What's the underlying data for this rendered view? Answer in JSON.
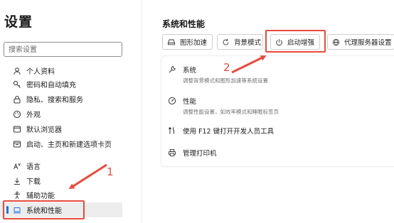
{
  "sidebar": {
    "title": "设置",
    "search_placeholder": "搜索设置",
    "items": [
      {
        "label": "个人资料",
        "icon": "profile-icon"
      },
      {
        "label": "密码和自动填充",
        "icon": "key-icon"
      },
      {
        "label": "隐私、搜索和服务",
        "icon": "lock-icon"
      },
      {
        "label": "外观",
        "icon": "appearance-icon"
      },
      {
        "label": "默认浏览器",
        "icon": "browser-icon"
      },
      {
        "label": "启动、主页和新建选项卡页",
        "icon": "power-icon"
      },
      {
        "label": "语言",
        "icon": "language-icon"
      },
      {
        "label": "下载",
        "icon": "download-icon"
      },
      {
        "label": "辅助功能",
        "icon": "accessibility-icon"
      },
      {
        "label": "系统和性能",
        "icon": "laptop-icon"
      }
    ]
  },
  "main": {
    "section_title": "系统和性能",
    "tabs": [
      {
        "label": "图形加速",
        "icon": "drive-icon"
      },
      {
        "label": "背景模式",
        "icon": "refresh-icon"
      },
      {
        "label": "启动增强",
        "icon": "power-icon"
      },
      {
        "label": "代理服务器设置",
        "icon": "globe-icon"
      }
    ],
    "rows": [
      {
        "title": "系统",
        "desc": "调整背景模式和图形加速等系统设置",
        "icon": "wrench-icon"
      },
      {
        "title": "性能",
        "desc": "调整性能设置，如效率模式和睡眠标签页",
        "icon": "gauge-icon"
      },
      {
        "title": "使用 F12 键打开开发人员工具",
        "desc": "",
        "icon": "devtools-icon"
      },
      {
        "title": "管理打印机",
        "desc": "",
        "icon": "printer-icon"
      }
    ]
  },
  "annotations": {
    "step1": "1",
    "step2": "2",
    "color": "#e84b3c"
  },
  "colors": {
    "accent": "#1a73e8",
    "active_bg": "#ededed"
  }
}
